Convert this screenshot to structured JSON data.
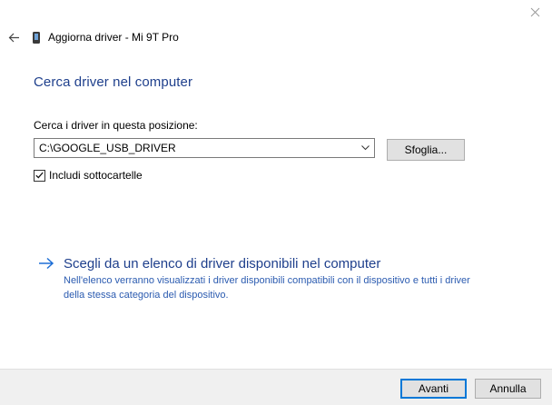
{
  "window": {
    "title": "Aggiorna driver - Mi 9T Pro"
  },
  "icons": {
    "close": "close-icon",
    "back": "back-arrow-icon",
    "device": "phone-icon",
    "link": "arrow-right-icon",
    "check": "checkmark-icon"
  },
  "page": {
    "title": "Cerca driver nel computer"
  },
  "search": {
    "label": "Cerca i driver in questa posizione:",
    "path_value": "C:\\GOOGLE_USB_DRIVER",
    "browse_label": "Sfoglia...",
    "include_subfolders_label": "Includi sottocartelle",
    "include_subfolders_checked": true
  },
  "pick_from_list": {
    "title": "Scegli da un elenco di driver disponibili nel computer",
    "description": "Nell'elenco verranno visualizzati i driver disponibili compatibili con il dispositivo e tutti i driver della stessa categoria del dispositivo."
  },
  "footer": {
    "next_label": "Avanti",
    "cancel_label": "Annulla"
  },
  "colors": {
    "accent": "#1e3f8c",
    "link_desc": "#2b5bb0",
    "focus_border": "#0078d7",
    "footer_bg": "#f0f0f0"
  }
}
